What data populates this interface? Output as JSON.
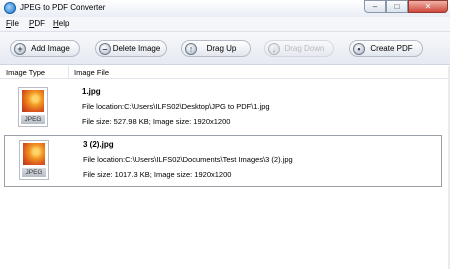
{
  "window": {
    "title": "JPEG to PDF Converter",
    "controls": {
      "minimize": "–",
      "maximize": "□",
      "close": "✕"
    }
  },
  "menu": [
    {
      "key": "F",
      "rest": "ile"
    },
    {
      "key": "P",
      "rest": "DF"
    },
    {
      "key": "H",
      "rest": "elp"
    }
  ],
  "toolbar": {
    "add": {
      "label": "Add Image",
      "icon": "plus-icon",
      "glyph": "+"
    },
    "delete": {
      "label": "Delete Image",
      "icon": "minus-icon",
      "glyph": "–"
    },
    "up": {
      "label": "Drag Up",
      "icon": "arrow-up-icon",
      "glyph": "↑"
    },
    "down": {
      "label": "Drag Down",
      "icon": "arrow-down-icon",
      "glyph": "↓",
      "disabled": true
    },
    "create": {
      "label": "Create PDF",
      "icon": "create-pdf-icon",
      "glyph": "•"
    }
  },
  "list": {
    "columns": {
      "type": "Image Type",
      "file": "Image File"
    },
    "rows": [
      {
        "badge": "JPEG",
        "name": "1.jpg",
        "location": "File location:C:\\Users\\ILFS02\\Desktop\\JPG to PDF\\1.jpg",
        "size": "File size:  527.98 KB;  Image size:  1920x1200",
        "selected": false
      },
      {
        "badge": "JPEG",
        "name": "3 (2).jpg",
        "location": "File location:C:\\Users\\ILFS02\\Documents\\Test Images\\3 (2).jpg",
        "size": "File size:  1017.3 KB;  Image size:  1920x1200",
        "selected": true
      }
    ]
  }
}
